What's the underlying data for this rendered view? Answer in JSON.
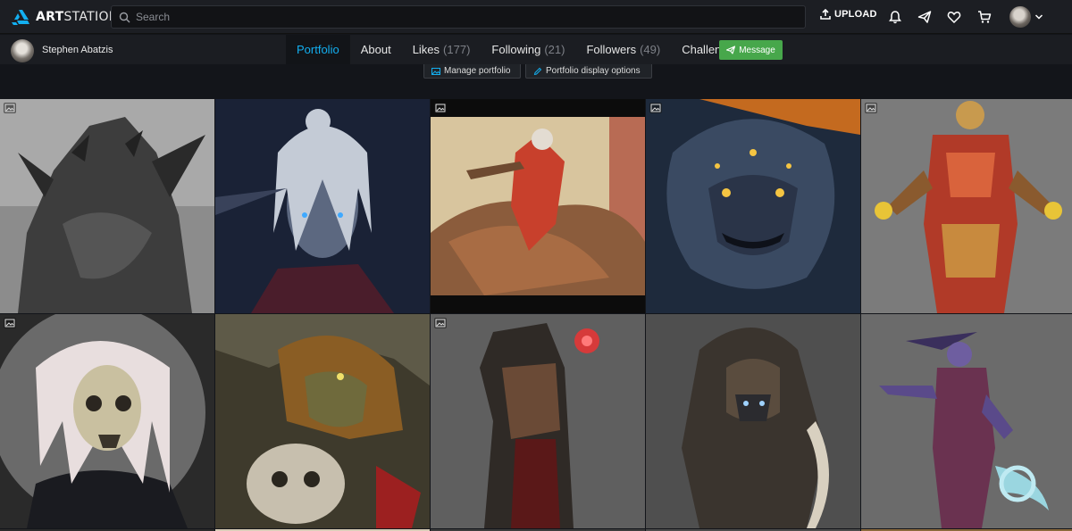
{
  "header": {
    "logo_text_bold": "ART",
    "logo_text": "STATION",
    "search_placeholder": "Search",
    "upload_label": "UPLOAD",
    "icons": [
      "bell-icon",
      "send-icon",
      "heart-icon",
      "cart-icon",
      "avatar",
      "chevron-down-icon"
    ]
  },
  "profile": {
    "name": "Stephen Abatzis",
    "tabs": [
      {
        "label": "Portfolio",
        "count": ""
      },
      {
        "label": "About",
        "count": ""
      },
      {
        "label": "Likes",
        "count": "(177)"
      },
      {
        "label": "Following",
        "count": "(21)"
      },
      {
        "label": "Followers",
        "count": "(49)"
      },
      {
        "label": "Challenges",
        "count": ""
      }
    ],
    "message_label": "Message"
  },
  "options": {
    "manage_label": "Manage portfolio",
    "display_label": "Portfolio display options"
  },
  "colors": {
    "accent_blue": "#13aff0",
    "message_green": "#47a74b",
    "nav_bg": "#1c1e23",
    "page_bg": "#13151a"
  }
}
